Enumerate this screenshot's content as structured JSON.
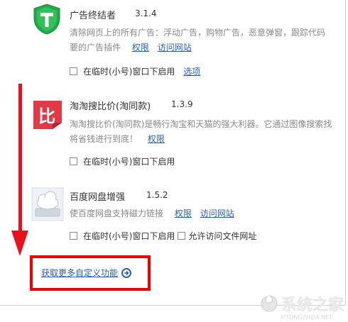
{
  "extensions": [
    {
      "name": "广告终结者",
      "version": "3.1.4",
      "desc_line1": "清除网页上的所有广告：浮动广告，购物广告，恶意弹窗，跟踪代码",
      "desc_line2": "要的广告插件",
      "link_permissions": "权限",
      "link_site": "访问网站",
      "option_incognito": "在临时(小号)窗口下启用",
      "link_options": "选项"
    },
    {
      "name": "淘淘搜比价(淘同款)",
      "version": "1.3.9",
      "icon_glyph": "比",
      "desc_line1": "淘淘搜比价(淘同款)是畅行淘宝和天猫的强大利器。它通过图像搜索找",
      "desc_line2": "将省钱进行到底！",
      "link_permissions": "权限",
      "option_incognito": "在临时(小号)窗口下启用"
    },
    {
      "name": "百度网盘增强",
      "version": "1.5.2",
      "desc_line1": "使百度网盘支持磁力链接",
      "link_permissions": "权限",
      "link_site": "访问网站",
      "option_incognito": "在临时(小号)窗口下启用",
      "option_file_url": "允许访问文件网址"
    }
  ],
  "more_link": "获取更多自定义功能",
  "watermark": {
    "text": "系统之家",
    "url": "XITONGZHIJIA.NET"
  },
  "colors": {
    "accent_link": "#2a5db0",
    "annotation_red": "#e8101a",
    "shield_green": "#22a84a",
    "badge_red": "#e23a45"
  }
}
